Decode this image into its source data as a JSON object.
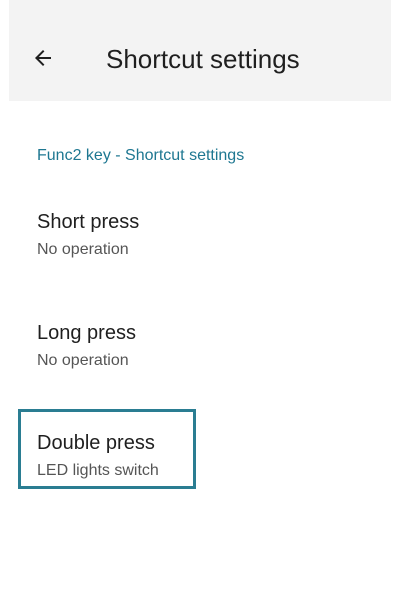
{
  "header": {
    "title": "Shortcut settings",
    "back_icon": "arrow-left-icon",
    "background_color": "#f3f3f3"
  },
  "section": {
    "header": "Func2 key - Shortcut settings",
    "accent_color": "#1e7791"
  },
  "items": [
    {
      "title": "Short press",
      "summary": "No operation"
    },
    {
      "title": "Long press",
      "summary": "No operation"
    },
    {
      "title": "Double press",
      "summary": "LED lights switch",
      "highlighted": true
    }
  ],
  "highlight_color": "#2a7d92"
}
